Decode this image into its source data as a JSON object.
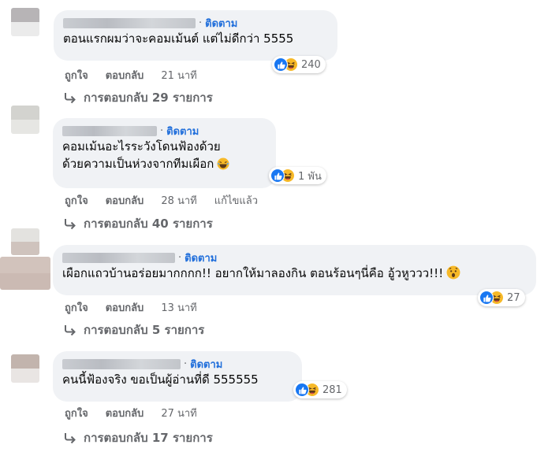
{
  "follow_label": "ติดตาม",
  "separator": "·",
  "actions": {
    "like": "ถูกใจ",
    "reply": "ตอบกลับ"
  },
  "comments": [
    {
      "lines": [
        "ตอนแรกผมว่าจะคอมเม้นต์ แต่ไม่ดีกว่า 5555"
      ],
      "reaction_count": "240",
      "time": "21 นาที",
      "edited": "",
      "replies": "การตอบกลับ 29 รายการ"
    },
    {
      "lines": [
        "คอมเม้นอะไรระวังโดนฟ้องด้วย",
        "ด้วยความเป็นห่วงจากทีมเผือก"
      ],
      "reaction_count": "1 พัน",
      "time": "28 นาที",
      "edited": "แก้ไขแล้ว",
      "replies": "การตอบกลับ 40 รายการ"
    },
    {
      "lines": [
        "เผือกแถวบ้านอร่อยมากกกก!! อยากให้มาลองกิน ตอนร้อนๆนี่คือ อู้วหูววว!!!"
      ],
      "reaction_count": "27",
      "time": "13 นาที",
      "edited": "",
      "replies": "การตอบกลับ 5 รายการ"
    },
    {
      "lines": [
        "คนนี้ฟ้องจริง ขอเป็นผู้อ่านที่ดี 555555"
      ],
      "reaction_count": "281",
      "time": "27 นาที",
      "edited": "",
      "replies": "การตอบกลับ 17 รายการ"
    }
  ],
  "colors": {
    "bubble": "#f0f2f5",
    "follow": "#216fdb",
    "secondary_text": "#65676b",
    "like_blue": "#1877f2",
    "emoji_yellow": "#f7b928"
  }
}
